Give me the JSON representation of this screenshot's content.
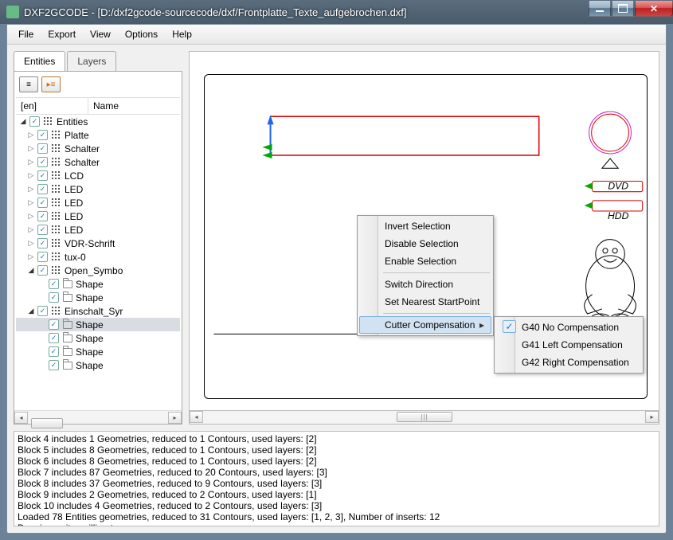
{
  "window": {
    "title": "DXF2GCODE - [D:/dxf2gcode-sourcecode/dxf/Frontplatte_Texte_aufgebrochen.dxf]"
  },
  "menu": {
    "items": [
      "File",
      "Export",
      "View",
      "Options",
      "Help"
    ]
  },
  "tabs": {
    "active": "Entities",
    "inactive": "Layers"
  },
  "tree_header": {
    "col1": "[en]",
    "col2": "Name"
  },
  "tree": [
    {
      "depth": 0,
      "arrow": "open",
      "checked": true,
      "icon": "grid",
      "label": "Entities"
    },
    {
      "depth": 1,
      "arrow": "closed",
      "checked": true,
      "icon": "grid",
      "label": "Platte"
    },
    {
      "depth": 1,
      "arrow": "closed",
      "checked": true,
      "icon": "grid",
      "label": "Schalter"
    },
    {
      "depth": 1,
      "arrow": "closed",
      "checked": true,
      "icon": "grid",
      "label": "Schalter"
    },
    {
      "depth": 1,
      "arrow": "closed",
      "checked": true,
      "icon": "grid",
      "label": "LCD"
    },
    {
      "depth": 1,
      "arrow": "closed",
      "checked": true,
      "icon": "grid",
      "label": "LED"
    },
    {
      "depth": 1,
      "arrow": "closed",
      "checked": true,
      "icon": "grid",
      "label": "LED"
    },
    {
      "depth": 1,
      "arrow": "closed",
      "checked": true,
      "icon": "grid",
      "label": "LED"
    },
    {
      "depth": 1,
      "arrow": "closed",
      "checked": true,
      "icon": "grid",
      "label": "LED"
    },
    {
      "depth": 1,
      "arrow": "closed",
      "checked": true,
      "icon": "grid",
      "label": "VDR-Schrift"
    },
    {
      "depth": 1,
      "arrow": "closed",
      "checked": true,
      "icon": "grid",
      "label": "tux-0"
    },
    {
      "depth": 1,
      "arrow": "open",
      "checked": true,
      "icon": "grid",
      "label": "Open_Symbo"
    },
    {
      "depth": 2,
      "arrow": "",
      "checked": true,
      "icon": "folder",
      "label": "Shape"
    },
    {
      "depth": 2,
      "arrow": "",
      "checked": true,
      "icon": "folder",
      "label": "Shape"
    },
    {
      "depth": 1,
      "arrow": "open",
      "checked": true,
      "icon": "grid",
      "label": "Einschalt_Syr"
    },
    {
      "depth": 2,
      "arrow": "",
      "checked": true,
      "icon": "folder",
      "label": "Shape",
      "selected": true
    },
    {
      "depth": 2,
      "arrow": "",
      "checked": true,
      "icon": "folder",
      "label": "Shape"
    },
    {
      "depth": 2,
      "arrow": "",
      "checked": true,
      "icon": "folder",
      "label": "Shape"
    },
    {
      "depth": 2,
      "arrow": "",
      "checked": true,
      "icon": "folder",
      "label": "Shape"
    }
  ],
  "context_menu": {
    "groups": [
      [
        "Invert Selection",
        "Disable Selection",
        "Enable Selection"
      ],
      [
        "Switch Direction",
        "Set Nearest StartPoint"
      ],
      [
        "Cutter Compensation"
      ]
    ],
    "submenu": {
      "items": [
        "G40 No Compensation",
        "G41 Left Compensation",
        "G42 Right Compensation"
      ],
      "checked_index": 0
    }
  },
  "drawing_labels": {
    "dvd": "DVD",
    "hdd": "HDD"
  },
  "log_lines": [
    "Block 4 includes 1 Geometries, reduced to 1 Contours, used layers: [2]",
    "Block 5 includes 8 Geometries, reduced to 1 Contours, used layers: [2]",
    "Block 6 includes 8 Geometries, reduced to 1 Contours, used layers: [2]",
    "Block 7 includes 87 Geometries, reduced to 20 Contours, used layers: [3]",
    "Block 8 includes 37 Geometries, reduced to 9 Contours, used layers: [3]",
    "Block 9 includes 2 Geometries, reduced to 2 Contours, used layers: [1]",
    "Block 10 includes 4 Geometries, reduced to 2 Contours, used layers: [3]",
    "Loaded 78 Entities geometries, reduced to 31 Contours, used layers: [1, 2, 3], Number of inserts: 12",
    "Drawing units: millimeters"
  ]
}
